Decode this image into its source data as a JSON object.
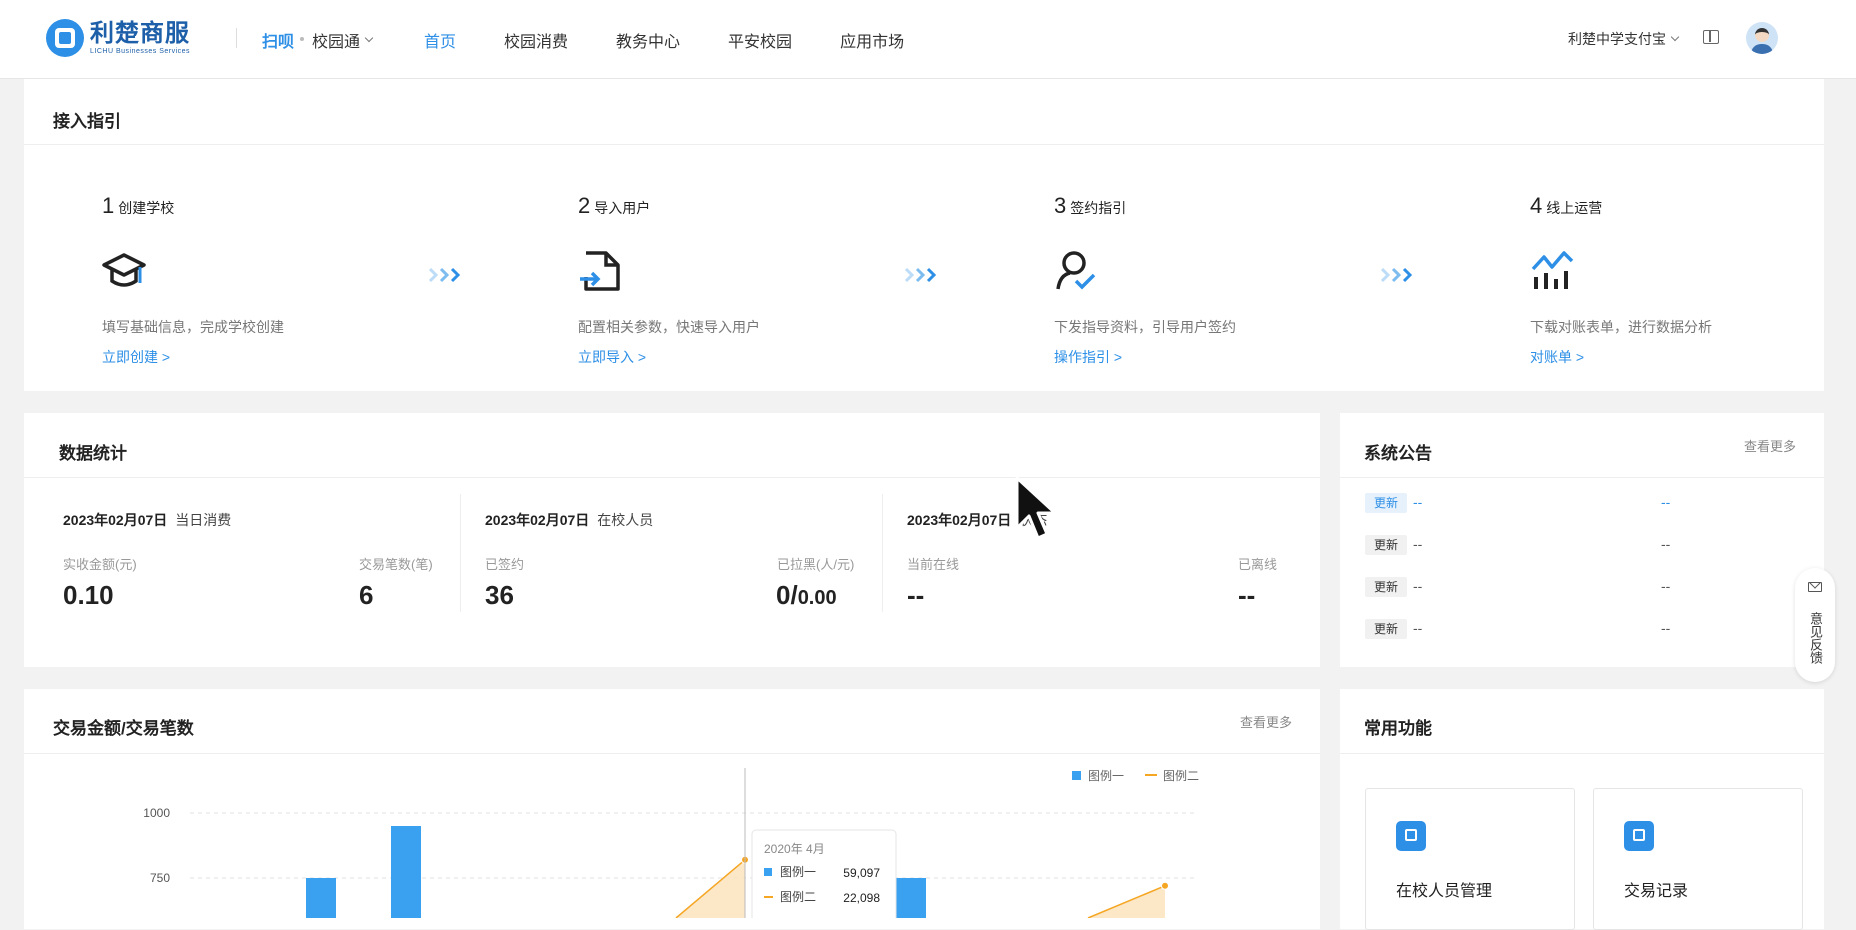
{
  "header": {
    "logo_cn": "利楚商服",
    "logo_en": "LICHU Businesses Services",
    "brand": "扫呗",
    "product": "校园通",
    "nav": [
      "首页",
      "校园消费",
      "教务中心",
      "平安校园",
      "应用市场"
    ],
    "active_nav": "首页",
    "school": "利楚中学支付宝"
  },
  "guide": {
    "title": "接入指引",
    "steps": [
      {
        "num": "1",
        "name": "创建学校",
        "desc": "填写基础信息，完成学校创建",
        "link": "立即创建 >",
        "icon": "graduation-cap-icon"
      },
      {
        "num": "2",
        "name": "导入用户",
        "desc": "配置相关参数，快速导入用户",
        "link": "立即导入 >",
        "icon": "file-import-icon"
      },
      {
        "num": "3",
        "name": "签约指引",
        "desc": "下发指导资料，引导用户签约",
        "link": "操作指引 >",
        "icon": "user-check-icon"
      },
      {
        "num": "4",
        "name": "线上运营",
        "desc": "下载对账表单，进行数据分析",
        "link": "对账单 >",
        "icon": "chart-icon"
      }
    ]
  },
  "stats": {
    "title": "数据统计",
    "cols": [
      {
        "date": "2023年02月07日",
        "kind": "当日消费",
        "l1": "实收金额(元)",
        "v1": "0.10",
        "l2": "交易笔数(笔)",
        "v2": "6"
      },
      {
        "date": "2023年02月07日",
        "kind": "在校人员",
        "l1": "已签约",
        "v1": "36",
        "l2": "已拉黑(人/元)",
        "v2a": "0/",
        "v2b": "0.00"
      },
      {
        "date": "2023年02月07日",
        "kind": "状态",
        "l1": "当前在线",
        "v1": "--",
        "l2": "已离线",
        "v2": "--"
      }
    ]
  },
  "notice": {
    "title": "系统公告",
    "more": "查看更多",
    "rows": [
      {
        "tag": "更新",
        "a": "--",
        "b": "--"
      },
      {
        "tag": "更新",
        "a": "--",
        "b": "--"
      },
      {
        "tag": "更新",
        "a": "--",
        "b": "--"
      },
      {
        "tag": "更新",
        "a": "--",
        "b": "--"
      }
    ]
  },
  "trade": {
    "title": "交易金额/交易笔数",
    "more": "查看更多"
  },
  "chart_data": {
    "type": "bar",
    "series": [
      {
        "name": "图例一",
        "type": "bar"
      },
      {
        "name": "图例二",
        "type": "line"
      }
    ],
    "ticks": [
      "1000",
      "750"
    ],
    "ylim_visible": [
      750,
      1000
    ],
    "visible_bars": [
      750,
      950,
      750
    ],
    "line_points_visible": [
      820,
      720
    ],
    "colors": {
      "series1": "#3aa0f0",
      "series2": "#f5a623"
    },
    "tooltip": {
      "title": "2020年 4月",
      "rows": [
        {
          "name": "图例一",
          "value": "59,097"
        },
        {
          "name": "图例二",
          "value": "22,098"
        }
      ]
    }
  },
  "quick": {
    "title": "常用功能",
    "items": [
      "在校人员管理",
      "交易记录"
    ]
  },
  "feedback": {
    "label": "意见反馈",
    "icon": "mail-icon"
  },
  "colors": {
    "accent": "#2d8fe6"
  }
}
